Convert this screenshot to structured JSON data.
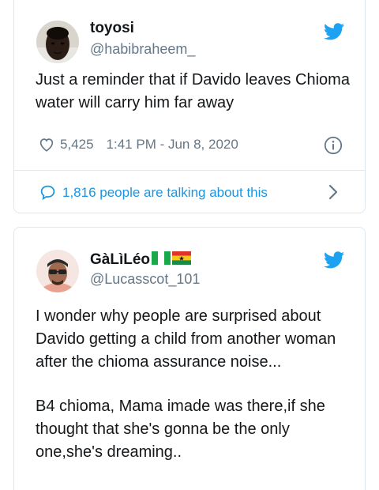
{
  "colors": {
    "twitter_blue": "#1da1f2",
    "link_blue": "#1b95e0",
    "text_dark": "#14171a",
    "text_gray": "#657786",
    "border": "#e1e8ed"
  },
  "tweets": [
    {
      "display_name": "toyosi",
      "handle": "@habibraheem_",
      "text": [
        "Just a reminder that if Davido leaves Chioma water will carry him far away"
      ],
      "likes": "5,425",
      "timestamp": "1:41 PM - Jun 8, 2020",
      "talking": "1,816 people are talking about this",
      "icons": {
        "brand": "twitter-bird-icon",
        "likes": "heart-icon",
        "info": "info-icon",
        "talking": "speech-bubble-icon",
        "more": "chevron-right-icon"
      }
    },
    {
      "display_name": "GàLìLéo",
      "handle": "@Lucasscot_101",
      "name_flags": [
        "nigeria-flag-icon",
        "ghana-flag-icon"
      ],
      "text": [
        "I wonder why people are surprised about Davido getting a child from another woman after the chioma assurance noise...",
        "B4 chioma, Mama imade was there,if she thought that she's gonna be the only one,she's dreaming.."
      ],
      "icons": {
        "brand": "twitter-bird-icon"
      }
    }
  ]
}
